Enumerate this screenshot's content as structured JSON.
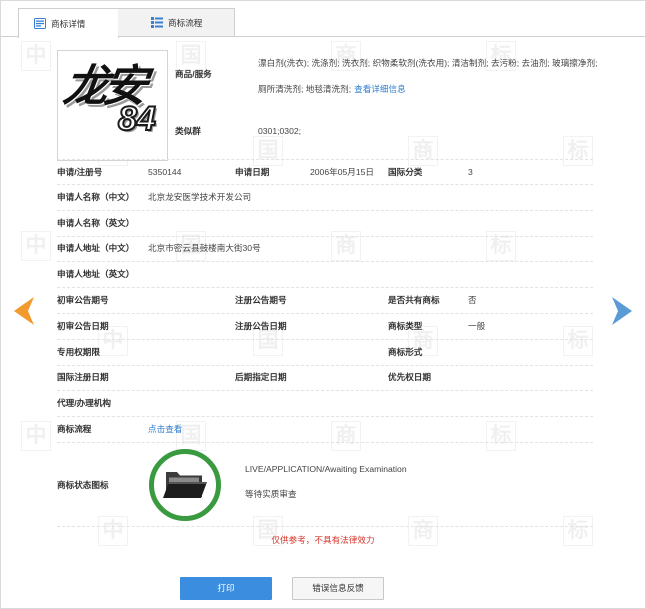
{
  "tabs": [
    {
      "label": "商标详情",
      "icon": "document-icon",
      "active": true
    },
    {
      "label": "商标流程",
      "icon": "list-icon",
      "active": false
    }
  ],
  "logo": {
    "main": "龙安",
    "number": "84"
  },
  "goods": {
    "label": "商品/服务",
    "text": "漂白剂(洗衣); 洗涤剂; 洗衣剂; 织物柔软剂(洗衣用); 清洁制剂; 去污粉; 去油剂; 玻璃擦净剂; 厕所清洗剂; 地毯清洗剂;",
    "link": "查看详细信息"
  },
  "similar_group": {
    "label": "类似群",
    "value": "0301;0302;"
  },
  "details": {
    "reg_no": {
      "label": "申请/注册号",
      "value": "5350144"
    },
    "apply_date": {
      "label": "申请日期",
      "value": "2006年05月15日"
    },
    "intl_class": {
      "label": "国际分类",
      "value": "3"
    },
    "applicant_name_cn": {
      "label": "申请人名称（中文）",
      "value": "北京龙安医学技术开发公司"
    },
    "applicant_name_en": {
      "label": "申请人名称（英文）"
    },
    "applicant_address_cn": {
      "label": "申请人地址（中文）",
      "value": "北京市密云县鼓楼南大街30号"
    },
    "applicant_address_en": {
      "label": "申请人地址（英文）"
    },
    "prelim_pub_no": {
      "label": "初审公告期号"
    },
    "reg_pub_no": {
      "label": "注册公告期号"
    },
    "shared_mark": {
      "label": "是否共有商标",
      "value": "否"
    },
    "prelim_pub_date": {
      "label": "初审公告日期"
    },
    "reg_pub_date": {
      "label": "注册公告日期"
    },
    "mark_type": {
      "label": "商标类型",
      "value": "一般"
    },
    "exclusive_term": {
      "label": "专用权期限"
    },
    "mark_form": {
      "label": "商标形式"
    },
    "intl_reg_date": {
      "label": "国际注册日期"
    },
    "later_designation_date": {
      "label": "后期指定日期"
    },
    "priority_date": {
      "label": "优先权日期"
    },
    "agency": {
      "label": "代理/办理机构"
    },
    "process": {
      "label": "商标流程",
      "link": "点击查看"
    }
  },
  "status": {
    "label": "商标状态图标",
    "icon": "folder-icon",
    "text_en": "LIVE/APPLICATION/Awaiting Examination",
    "text_cn": "等待实质审查"
  },
  "disclaimer": "仅供参考，不具有法律效力",
  "buttons": {
    "print": "打印",
    "feedback": "错误信息反馈"
  },
  "nav": {
    "prev_icon": "chevron-left-icon",
    "next_icon": "chevron-right-icon"
  },
  "watermark": "中国商标",
  "colors": {
    "accent": "#3b8de0",
    "link": "#2f7ccf",
    "disclaimer": "#d9342b",
    "status_ring": "#3a9a40",
    "prev_arrow": "#f39a2e",
    "next_arrow": "#5b9bd5"
  }
}
